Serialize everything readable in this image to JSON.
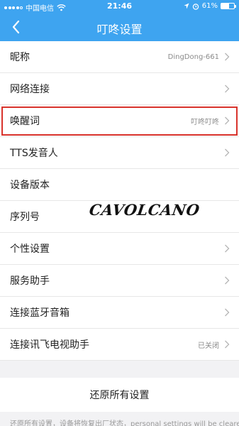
{
  "status_bar": {
    "carrier": "中国电信",
    "time": "21:46",
    "battery_text": "61%",
    "battery_level": 0.61,
    "signal_bars": 4
  },
  "nav": {
    "title": "叮咚设置",
    "back_icon": "chevron-left-icon"
  },
  "settings": {
    "nickname": {
      "label": "昵称",
      "value": "DingDong-661"
    },
    "network": {
      "label": "网络连接"
    },
    "wake_word": {
      "label": "唤醒词",
      "value": "叮咚叮咚"
    },
    "tts_voice": {
      "label": "TTS发音人"
    },
    "device_version": {
      "label": "设备版本"
    },
    "serial_number": {
      "label": "序列号"
    },
    "personal": {
      "label": "个性设置"
    },
    "service_assistant": {
      "label": "服务助手"
    },
    "bluetooth_speaker": {
      "label": "连接蓝牙音箱"
    },
    "tv_assistant": {
      "label": "连接讯飞电视助手",
      "value": "已关闭"
    }
  },
  "reset": {
    "label": "还原所有设置"
  },
  "footer_text": "还原所有设置，设备将恢复出厂状态，personal settings will be cleared",
  "watermark": "CAVOLCANO",
  "colors": {
    "header": "#3ea4f0",
    "highlight": "#d8332c"
  }
}
